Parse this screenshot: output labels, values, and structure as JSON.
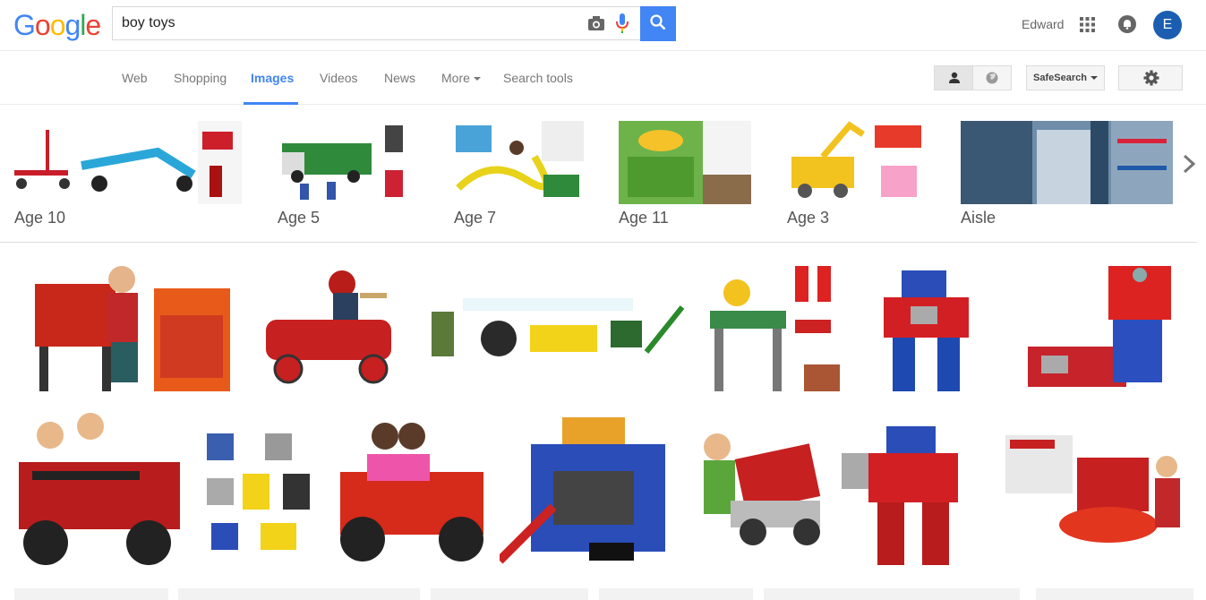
{
  "header": {
    "logo": "Google",
    "query": "boy toys",
    "user_name": "Edward",
    "avatar_letter": "E"
  },
  "nav": {
    "tabs": [
      "Web",
      "Shopping",
      "Images",
      "Videos",
      "News",
      "More",
      "Search tools"
    ],
    "safesearch": "SafeSearch"
  },
  "related": [
    "Age 10",
    "Age 5",
    "Age 7",
    "Age 11",
    "Age 3",
    "Aisle"
  ],
  "colors": {
    "accent": "#4285f4",
    "avatar": "#1b5eb1"
  }
}
